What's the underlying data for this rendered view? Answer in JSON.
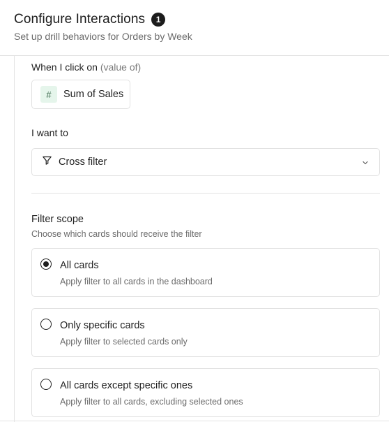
{
  "header": {
    "title": "Configure Interactions",
    "badge": "1",
    "subtitle": "Set up drill behaviors for Orders by Week"
  },
  "click_on": {
    "label": "When I click on",
    "hint": "(value of)",
    "chip_icon": "hash-icon",
    "chip_label": "Sum of Sales"
  },
  "action": {
    "label": "I want to",
    "icon": "filter-icon",
    "selected": "Cross filter"
  },
  "scope": {
    "title": "Filter scope",
    "description": "Choose which cards should receive the filter",
    "options": [
      {
        "label": "All cards",
        "description": "Apply filter to all cards in the dashboard",
        "selected": true
      },
      {
        "label": "Only specific cards",
        "description": "Apply filter to selected cards only",
        "selected": false
      },
      {
        "label": "All cards except specific ones",
        "description": "Apply filter to all cards, excluding selected ones",
        "selected": false
      }
    ]
  },
  "colors": {
    "accent": "#1c1c1c",
    "chip_bg": "#e5f5eb",
    "border": "#e1e1e1"
  }
}
